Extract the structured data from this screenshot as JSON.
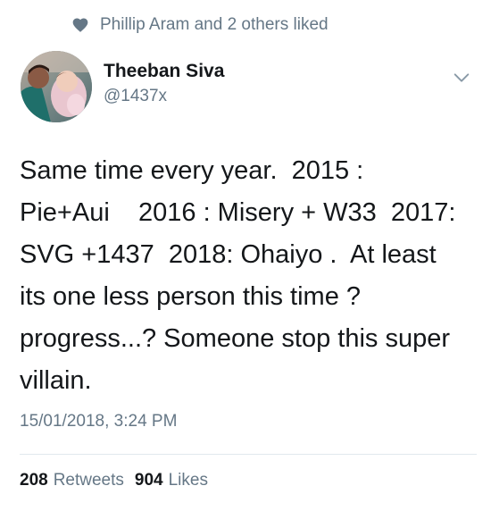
{
  "social_context": {
    "icon": "heart-icon",
    "text": "Phillip Aram and 2 others liked"
  },
  "author": {
    "display_name": "Theeban Siva",
    "handle": "@1437x",
    "avatar": "avatar-photo"
  },
  "menu_icon": "chevron-down-icon",
  "tweet": {
    "lines": [
      "Same time every year.  2015 :",
      "Pie+Aui    2016 : Misery + W33  2017:",
      "SVG +1437  2018: Ohaiyo .  At least",
      "its one less person this time ?",
      "progress...? Someone stop this super",
      "villain."
    ],
    "timestamp": "15/01/2018, 3:24 PM"
  },
  "stats": {
    "retweets_count": "208",
    "retweets_label": "Retweets",
    "likes_count": "904",
    "likes_label": "Likes"
  },
  "colors": {
    "text": "#14171a",
    "secondary": "#657786",
    "divider": "#e1e8ed"
  }
}
